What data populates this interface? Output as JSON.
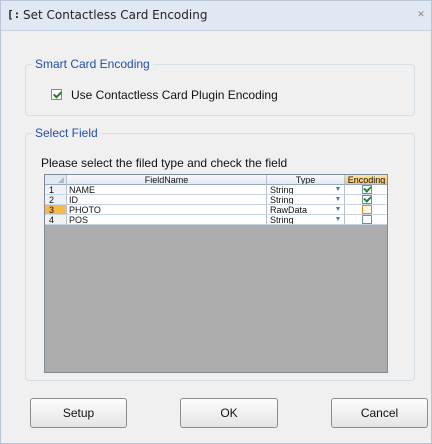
{
  "window": {
    "title": "Set Contactless Card Encoding",
    "icon": "app-window-icon",
    "close_icon": "close-icon"
  },
  "smart_card_encoding": {
    "legend": "Smart Card Encoding",
    "checkbox_label": "Use Contactless Card Plugin Encoding",
    "checked": true
  },
  "select_field": {
    "legend": "Select Field",
    "instruction": "Please select the filed type and check the field",
    "grid": {
      "columns": [
        "FieldName",
        "Type",
        "Encoding"
      ],
      "rows": [
        {
          "num": "1",
          "name": "NAME",
          "type": "String",
          "encoding": true,
          "selected": false
        },
        {
          "num": "2",
          "name": "ID",
          "type": "String",
          "encoding": true,
          "selected": false
        },
        {
          "num": "3",
          "name": "PHOTO",
          "type": "RawData",
          "encoding": false,
          "selected": true
        },
        {
          "num": "4",
          "name": "POS",
          "type": "String",
          "encoding": false,
          "selected": false
        }
      ]
    }
  },
  "buttons": {
    "setup": "Setup",
    "ok": "OK",
    "cancel": "Cancel"
  },
  "colors": {
    "legend_text": "#1f4fad",
    "selected_row_header": "#f7b94a",
    "encoding_header": "#f7c46a",
    "grid_empty_area": "#adadad"
  }
}
